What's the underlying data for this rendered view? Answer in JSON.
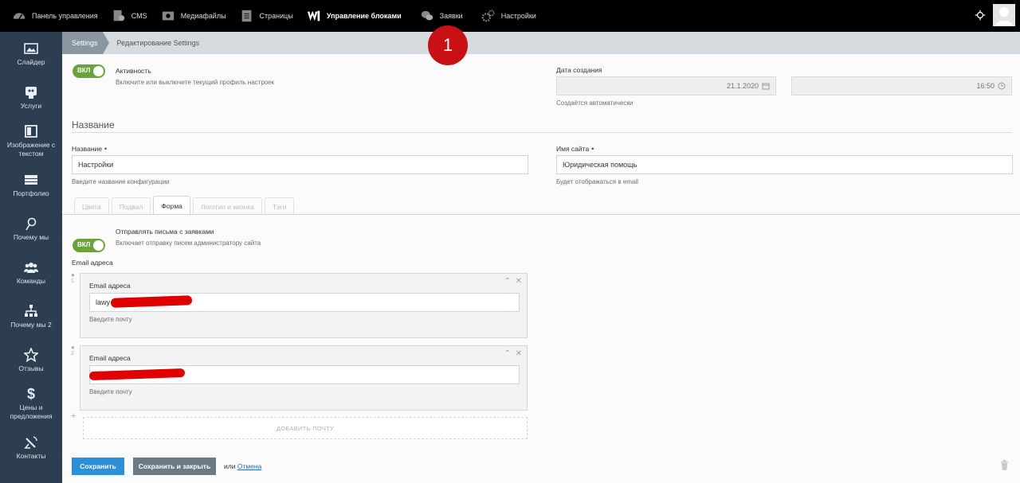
{
  "topnav": {
    "items": [
      {
        "label": "Панель управления",
        "icon": "dashboard-icon"
      },
      {
        "label": "CMS",
        "icon": "cms-icon"
      },
      {
        "label": "Медиафайлы",
        "icon": "media-icon"
      },
      {
        "label": "Страницы",
        "icon": "pages-icon"
      },
      {
        "label": "Управление блоками",
        "icon": "blocks-icon"
      },
      {
        "label": "Заявки",
        "icon": "chat-icon"
      },
      {
        "label": "Настройки",
        "icon": "gears-icon"
      }
    ],
    "active_index": 4
  },
  "sidebar": {
    "items": [
      {
        "label": "Слайдер",
        "icon": "image-icon"
      },
      {
        "label": "Услуги",
        "icon": "services-icon"
      },
      {
        "label": "Изображение с текстом",
        "icon": "image-text-icon"
      },
      {
        "label": "Портфолио",
        "icon": "portfolio-icon"
      },
      {
        "label": "Почему мы",
        "icon": "pin-icon"
      },
      {
        "label": "Команды",
        "icon": "team-icon"
      },
      {
        "label": "Почему мы 2",
        "icon": "sitemap-icon"
      },
      {
        "label": "Отзывы",
        "icon": "star-icon"
      },
      {
        "label": "Цены и предложения",
        "icon": "dollar-icon"
      },
      {
        "label": "Контакты",
        "icon": "satellite-icon"
      }
    ]
  },
  "breadcrumb": {
    "first": "Settings",
    "second": "Редактирование Settings"
  },
  "annotation_badge": "1",
  "activity": {
    "toggle": "ВКЛ",
    "label": "Активность",
    "hint": "Включите или выключите текущий профиль настроек"
  },
  "created": {
    "label": "Дата создания",
    "date": "21.1.2020",
    "time": "16:50",
    "hint": "Создаётся автоматически"
  },
  "section_title": "Название",
  "name_field": {
    "label": "Название",
    "value": "Настройки",
    "hint": "Введите название конфигурации"
  },
  "site_field": {
    "label": "Имя сайта",
    "value": "Юридическая помощь",
    "hint": "Будет отображаться в email"
  },
  "tabs": [
    "Цвета",
    "Подвал",
    "Форма",
    "Логотип и иконка",
    "Тэги"
  ],
  "active_tab": 2,
  "send_letters": {
    "toggle": "ВКЛ",
    "label": "Отправлять письма с заявками",
    "hint": "Включает отправку писем администратору сайта"
  },
  "emails": {
    "label": "Email адреса",
    "items": [
      {
        "num": "1",
        "label": "Email адреса",
        "value": "lawy",
        "hint": "Введите почту"
      },
      {
        "num": "2",
        "label": "Email адреса",
        "value": "",
        "hint": "Введите почту"
      }
    ],
    "add_button": "ДОБАВИТЬ ПОЧТУ"
  },
  "footer": {
    "save": "Сохранить",
    "save_close": "Сохранить и закрыть",
    "or": "или",
    "cancel": "Отмена"
  },
  "colors": {
    "topbar": "#000000",
    "sidebar": "#2c3e50",
    "toggle_on": "#6aa23b",
    "primary": "#2b90d9",
    "badge": "#c81015",
    "required": "#c0141a"
  }
}
